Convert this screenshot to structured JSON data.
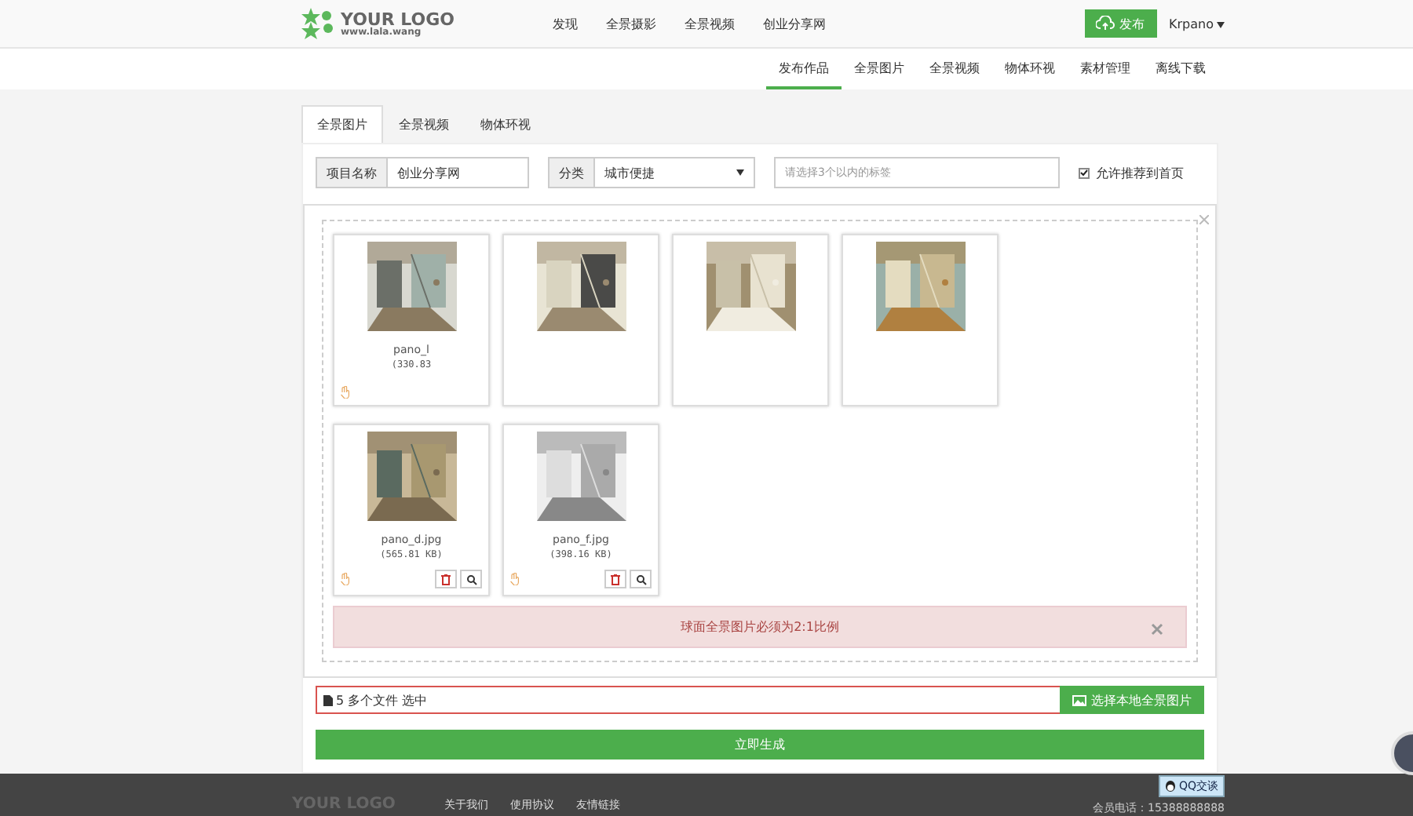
{
  "header": {
    "logo": {
      "title": "YOUR LOGO",
      "subtitle": "www.lala.wang"
    },
    "nav": [
      "发现",
      "全景摄影",
      "全景视频",
      "创业分享网"
    ],
    "publish_button": "发布",
    "user_menu": "Krpano"
  },
  "subnav": [
    {
      "label": "发布作品",
      "selected": true
    },
    {
      "label": "全景图片",
      "selected": false
    },
    {
      "label": "全景视频",
      "selected": false
    },
    {
      "label": "物体环视",
      "selected": false
    },
    {
      "label": "素材管理",
      "selected": false
    },
    {
      "label": "离线下载",
      "selected": false
    }
  ],
  "tabs": [
    {
      "label": "全景图片",
      "selected": true
    },
    {
      "label": "全景视频",
      "selected": false
    },
    {
      "label": "物体环视",
      "selected": false
    }
  ],
  "form": {
    "project_label": "项目名称",
    "project_value": "创业分享网",
    "category_label": "分类",
    "category_value": "城市便捷",
    "tags_placeholder": "请选择3个以内的标签",
    "recommend": {
      "label": "允许推荐到首页",
      "checked": true
    }
  },
  "files": [
    {
      "kind": "file",
      "name": "pano_l",
      "size": "(330.83",
      "actions": false
    },
    {
      "kind": "picture"
    },
    {
      "kind": "picture"
    },
    {
      "kind": "picture"
    },
    {
      "kind": "file",
      "name": "pano_d.jpg",
      "size": "(565.81 KB)",
      "actions": true
    },
    {
      "kind": "file",
      "name": "pano_f.jpg",
      "size": "(398.16 KB)",
      "actions": true
    }
  ],
  "alert": "球面全景图片必须为2:1比例",
  "file_input": {
    "value": "5 多个文件 选中",
    "button": "选择本地全景图片"
  },
  "submit": "立即生成",
  "footer": {
    "logo": "YOUR LOGO",
    "links": [
      "关于我们",
      "使用协议",
      "友情链接"
    ],
    "qq": "QQ交谈",
    "phone": "会员电话：15388888888"
  }
}
